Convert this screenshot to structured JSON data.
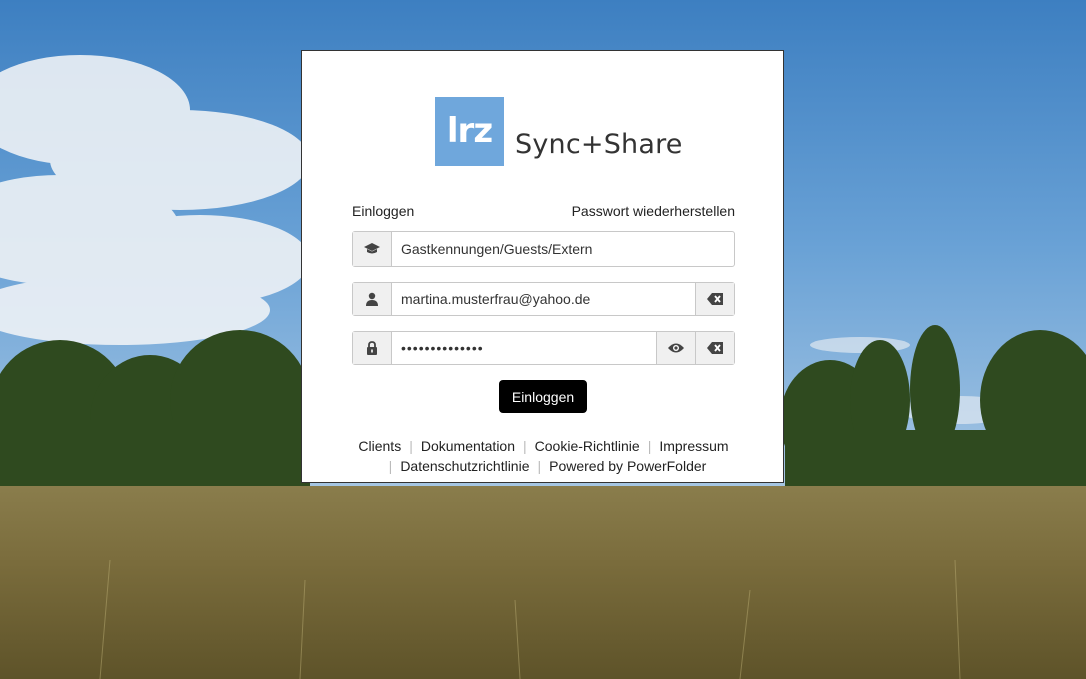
{
  "logo": {
    "mark_text": "lrz",
    "brand_text": "Sync+Share",
    "mark_color": "#6fa7dc"
  },
  "nav": {
    "login_label": "Einloggen",
    "forgot_password_label": "Passwort wiederherstellen"
  },
  "form": {
    "account_type_value": "Gastkennungen/Guests/Extern",
    "username_value": "martina.musterfrau@yahoo.de",
    "password_value": "••••••••••••••",
    "submit_label": "Einloggen"
  },
  "icons": {
    "account_type": "graduation-cap-icon",
    "user": "user-icon",
    "lock": "lock-icon",
    "show_password": "eye-icon",
    "clear": "backspace-clear-icon"
  },
  "footer": {
    "links_row1": [
      "Clients",
      "Dokumentation",
      "Cookie-Richtlinie",
      "Impressum"
    ],
    "links_row2": [
      "Datenschutzrichtlinie",
      "Powered by PowerFolder"
    ]
  },
  "colors": {
    "submit_bg": "#000000",
    "accent": "#6fa7dc"
  }
}
